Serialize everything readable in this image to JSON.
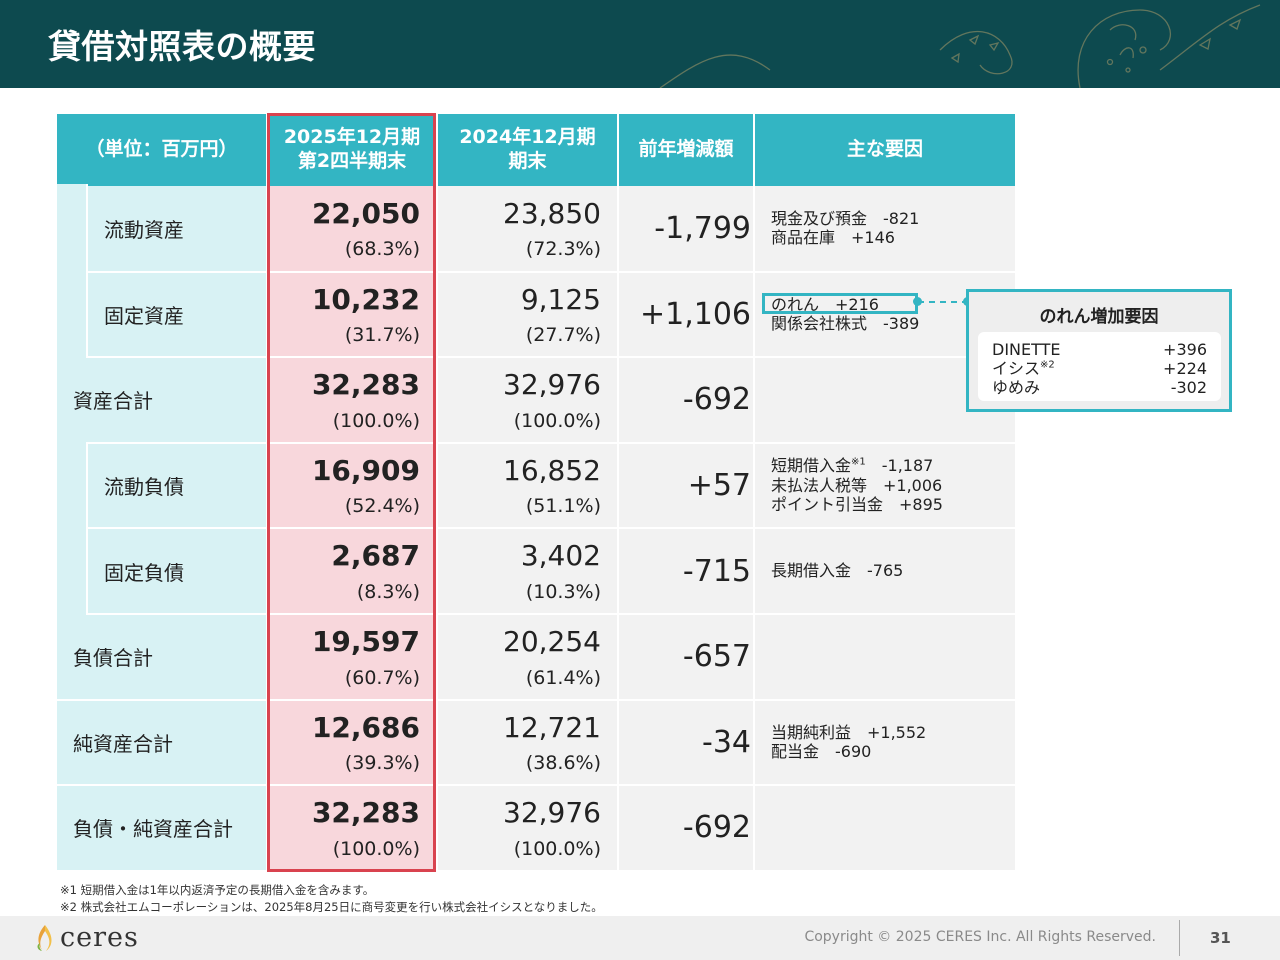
{
  "header": {
    "title": "貸借対照表の概要"
  },
  "table": {
    "headers": {
      "unit": "（単位：百万円）",
      "current_line1": "2025年12月期",
      "current_line2": "第2四半期末",
      "prev_line1": "2024年12月期",
      "prev_line2": "期末",
      "diff": "前年増減額",
      "factors": "主な要因"
    },
    "rows": [
      {
        "label": "流動資産",
        "indent": true,
        "current": "22,050",
        "current_pct": "(68.3%)",
        "prev": "23,850",
        "prev_pct": "(72.3%)",
        "diff": "-1,799",
        "factors": [
          "現金及び預金　-821",
          "商品在庫　+146"
        ]
      },
      {
        "label": "固定資産",
        "indent": true,
        "current": "10,232",
        "current_pct": "(31.7%)",
        "prev": "9,125",
        "prev_pct": "(27.7%)",
        "diff": "+1,106",
        "factors": [
          "のれん　+216",
          "関係会社株式　-389"
        ]
      },
      {
        "label": "資産合計",
        "indent": false,
        "current": "32,283",
        "current_pct": "(100.0%)",
        "prev": "32,976",
        "prev_pct": "(100.0%)",
        "diff": "-692",
        "factors": []
      },
      {
        "label": "流動負債",
        "indent": true,
        "current": "16,909",
        "current_pct": "(52.4%)",
        "prev": "16,852",
        "prev_pct": "(51.1%)",
        "diff": "+57",
        "factors": [
          "短期借入金",
          "未払法人税等　+1,006",
          "ポイント引当金　+895"
        ]
      },
      {
        "label": "固定負債",
        "indent": true,
        "current": "2,687",
        "current_pct": "(8.3%)",
        "prev": "3,402",
        "prev_pct": "(10.3%)",
        "diff": "-715",
        "factors": [
          "長期借入金　-765"
        ]
      },
      {
        "label": "負債合計",
        "indent": false,
        "current": "19,597",
        "current_pct": "(60.7%)",
        "prev": "20,254",
        "prev_pct": "(61.4%)",
        "diff": "-657",
        "factors": []
      },
      {
        "label": "純資産合計",
        "indent": false,
        "current": "12,686",
        "current_pct": "(39.3%)",
        "prev": "12,721",
        "prev_pct": "(38.6%)",
        "diff": "-34",
        "factors": [
          "当期純利益　+1,552",
          "配当金　-690"
        ]
      },
      {
        "label": "負債・純資産合計",
        "indent": false,
        "current": "32,283",
        "current_pct": "(100.0%)",
        "prev": "32,976",
        "prev_pct": "(100.0%)",
        "diff": "-692",
        "factors": []
      }
    ],
    "factor_extras": {
      "short_loan_note": "※1",
      "short_loan_value": "　-1,187"
    }
  },
  "callout": {
    "title": "のれん増加要因",
    "items": [
      {
        "name": "DINETTE",
        "note": "",
        "value": "+396"
      },
      {
        "name": "イシス",
        "note": "※2",
        "value": "+224"
      },
      {
        "name": "ゆめみ",
        "note": "",
        "value": "-302"
      }
    ]
  },
  "notes": [
    "※1 短期借入金は1年以内返済予定の長期借入金を含みます。",
    "※2 株式会社エムコーポレーションは、2025年8月25日に商号変更を行い株式会社イシスとなりました。"
  ],
  "footer": {
    "logo_text": "ceres",
    "copyright": "Copyright © 2025 CERES Inc. All Rights Reserved.",
    "page": "31"
  },
  "colors": {
    "header_bg": "#0d4a4f",
    "accent_teal": "#33b5c3",
    "highlight_red": "#d9434f",
    "current_col_bg": "#f8d7dc",
    "label_bg": "#d8f2f4"
  }
}
